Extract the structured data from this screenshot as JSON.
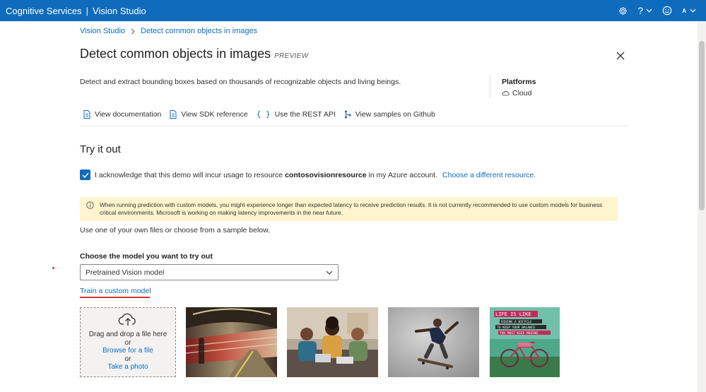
{
  "topbar": {
    "product": "Cognitive Services",
    "separator": "|",
    "app": "Vision Studio",
    "help_symbol": "?",
    "avatar_initial": "A"
  },
  "breadcrumb": {
    "root": "Vision Studio",
    "current": "Detect common objects in images"
  },
  "header": {
    "title": "Detect common objects in images",
    "badge": "PREVIEW"
  },
  "description": "Detect and extract bounding boxes based on thousands of recognizable objects and living beings.",
  "platforms": {
    "label": "Platforms",
    "value": "Cloud"
  },
  "links": [
    {
      "label": "View documentation",
      "icon": "document-icon"
    },
    {
      "label": "View SDK reference",
      "icon": "document-icon"
    },
    {
      "label": "Use the REST API",
      "icon": "braces-icon"
    },
    {
      "label": "View samples on Github",
      "icon": "branch-icon"
    }
  ],
  "try_it": {
    "heading": "Try it out",
    "ack_prefix": "I acknowledge that this demo will incur usage to resource",
    "resource": "contosovisionresource",
    "ack_suffix": "in my Azure account.",
    "change_resource": "Choose a different resource.",
    "ack_checked": true
  },
  "warning": "When running prediction with custom models, you might experience longer than expected latency to receive prediction results.  It is not currently recommended to use custom models for business critical environments. Microsoft is working on making latency improvements in the near future.",
  "use_hint": "Use one of your own files or choose from a sample below.",
  "model": {
    "label": "Choose the model you want to try out",
    "selected": "Pretrained Vision model",
    "train_link": "Train a custom model"
  },
  "upload": {
    "drag_text": "Drag and drop a file here",
    "or1": "or",
    "browse": "Browse for a file",
    "or2": "or",
    "photo": "Take a photo"
  },
  "samples": [
    {
      "name": "subway-train-sample"
    },
    {
      "name": "office-meeting-sample"
    },
    {
      "name": "skateboarder-sample"
    },
    {
      "name": "bicycle-poster-sample",
      "text_lines": [
        "LIFE IS LIKE",
        "RIDING A BICYCLE",
        "TO KEEP YOUR BALANCE",
        "YOU MUST KEEP MOVING"
      ]
    }
  ],
  "colors": {
    "accent": "#0f6cbd",
    "warning_bg": "#fff4ce",
    "highlight_red": "#d13438"
  }
}
